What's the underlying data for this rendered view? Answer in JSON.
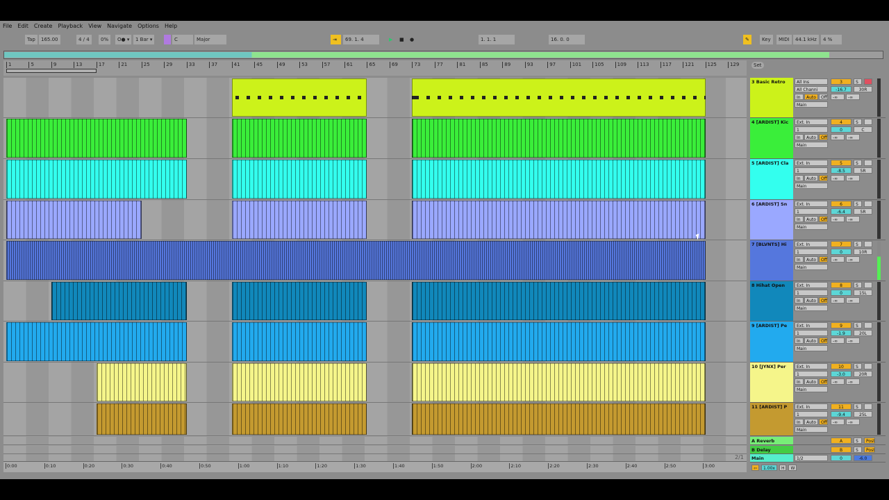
{
  "menu": [
    "File",
    "Edit",
    "Create",
    "Playback",
    "View",
    "Navigate",
    "Options",
    "Help"
  ],
  "toolbar": {
    "tap": "Tap",
    "tempo": "165.00",
    "signature": "4 / 4",
    "groove": "0%",
    "metronome": "O● ▾",
    "quantize": "1 Bar ▾",
    "key_root": "C",
    "scale": "Major",
    "position": "69.   1.   4",
    "loop_start": "1.   1.   1",
    "loop_length": "16.   0.   0",
    "key": "Key",
    "midi": "MIDI",
    "sample_rate": "44.1 kHz",
    "cpu": "4 %"
  },
  "ruler": {
    "bars": [
      "1",
      "5",
      "9",
      "13",
      "17",
      "21",
      "25",
      "29",
      "33",
      "37",
      "41",
      "45",
      "49",
      "53",
      "57",
      "61",
      "65",
      "69",
      "73",
      "77",
      "81",
      "85",
      "89",
      "93",
      "97",
      "101",
      "105",
      "109",
      "113",
      "117",
      "121",
      "125",
      "129"
    ],
    "set": "Set"
  },
  "tracks": [
    {
      "name": "3 Basic Retro",
      "color": "#ccf21a",
      "input": "All Ins",
      "channel": "All Channi",
      "num": "3",
      "vol": "-16.7",
      "pan": "30R",
      "monitor": "Auto",
      "clips": [
        [
          41,
          65
        ],
        [
          73,
          125
        ]
      ]
    },
    {
      "name": "4 [ARDIST] Kic",
      "color": "#3aee3a",
      "input": "Ext. In",
      "channel": "1",
      "num": "4",
      "vol": "0",
      "pan": "C",
      "monitor": "Off",
      "clips": [
        [
          1,
          33
        ],
        [
          41,
          65
        ],
        [
          73,
          125
        ]
      ]
    },
    {
      "name": "5 [ARDIST] Cla",
      "color": "#33ffee",
      "input": "Ext. In",
      "channel": "1",
      "num": "5",
      "vol": "-8.5",
      "pan": "5R",
      "monitor": "Off",
      "clips": [
        [
          1,
          33
        ],
        [
          41,
          65
        ],
        [
          73,
          125
        ]
      ]
    },
    {
      "name": "6 [ARDIST] Sn",
      "color": "#9aa8ff",
      "input": "Ext. In",
      "channel": "1",
      "num": "6",
      "vol": "-6.4",
      "pan": "5R",
      "monitor": "Off",
      "clips": [
        [
          1,
          25
        ],
        [
          41,
          65
        ],
        [
          73,
          125
        ]
      ]
    },
    {
      "name": "7 [BLVNTS] Hi",
      "color": "#5577dd",
      "input": "Ext. In",
      "channel": "1",
      "num": "7",
      "vol": "0",
      "pan": "10R",
      "monitor": "Off",
      "clips": [
        [
          1,
          125
        ]
      ]
    },
    {
      "name": "8 Hihat Open",
      "color": "#1188bb",
      "input": "Ext. In",
      "channel": "1",
      "num": "8",
      "vol": "0",
      "pan": "15L",
      "monitor": "Off",
      "clips": [
        [
          9,
          33
        ],
        [
          41,
          65
        ],
        [
          73,
          125
        ]
      ]
    },
    {
      "name": "9 [ARDIST] Pe",
      "color": "#22aaee",
      "input": "Ext. In",
      "channel": "1",
      "num": "9",
      "vol": "-1.9",
      "pan": "20L",
      "monitor": "Off",
      "clips": [
        [
          1,
          33
        ],
        [
          41,
          65
        ],
        [
          73,
          125
        ]
      ]
    },
    {
      "name": "10 [JYNX] Per",
      "color": "#f5f58a",
      "input": "Ext. In",
      "channel": "1",
      "num": "10",
      "vol": "-3.0",
      "pan": "20R",
      "monitor": "Off",
      "clips": [
        [
          17,
          33
        ],
        [
          41,
          65
        ],
        [
          73,
          125
        ]
      ]
    },
    {
      "name": "11 [ARDIST] P",
      "color": "#c49a30",
      "input": "Ext. In",
      "channel": "1",
      "num": "11",
      "vol": "-9.4",
      "pan": "25L",
      "monitor": "Off",
      "clips": [
        [
          17,
          33
        ],
        [
          41,
          65
        ],
        [
          73,
          125
        ]
      ]
    }
  ],
  "common": {
    "in": "In",
    "auto": "Auto",
    "off": "Off",
    "out": "Main",
    "solo": "S",
    "neg_inf": "-∞"
  },
  "returns": [
    {
      "name": "A Reverb",
      "color": "#77ee77",
      "letter": "A",
      "post": "Post"
    },
    {
      "name": "B Delay",
      "color": "#44cc44",
      "letter": "B",
      "post": "Post"
    }
  ],
  "main": {
    "name": "Main",
    "color": "#55eecc",
    "output": "1/2",
    "vol": "0",
    "pan": "-6.0"
  },
  "footer": {
    "zoom": "1.00x",
    "h": "H",
    "w": "W",
    "page": "2/1"
  },
  "times": [
    "0:00",
    "0:10",
    "0:20",
    "0:30",
    "0:40",
    "0:50",
    "1:00",
    "1:10",
    "1:20",
    "1:30",
    "1:40",
    "1:50",
    "2:00",
    "2:10",
    "2:20",
    "2:30",
    "2:40",
    "2:50",
    "3:00"
  ]
}
